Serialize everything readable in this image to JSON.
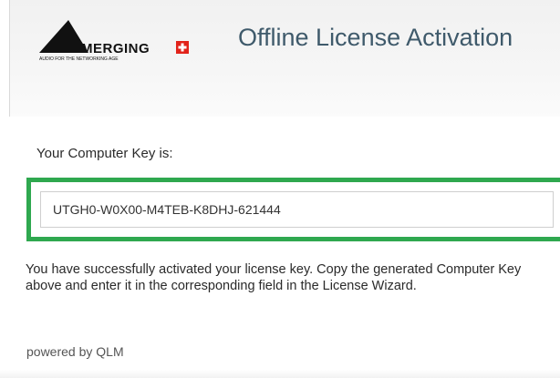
{
  "header": {
    "logo": {
      "brand": "MERGING",
      "tagline": "AUDIO FOR THE NETWORKING AGE",
      "icon": "merging-triangle-logo",
      "accent_color": "#e2231a"
    },
    "title": "Offline License Activation"
  },
  "computer_key": {
    "label": "Your Computer Key is:",
    "value": "UTGH0-W0X00-M4TEB-K8DHJ-621444",
    "highlight_color": "#2fa84f"
  },
  "message": "You have successfully activated your license key. Copy the generated Computer Key above and enter it in the corresponding field in the License Wizard.",
  "footer": {
    "powered_by": "powered by QLM"
  }
}
